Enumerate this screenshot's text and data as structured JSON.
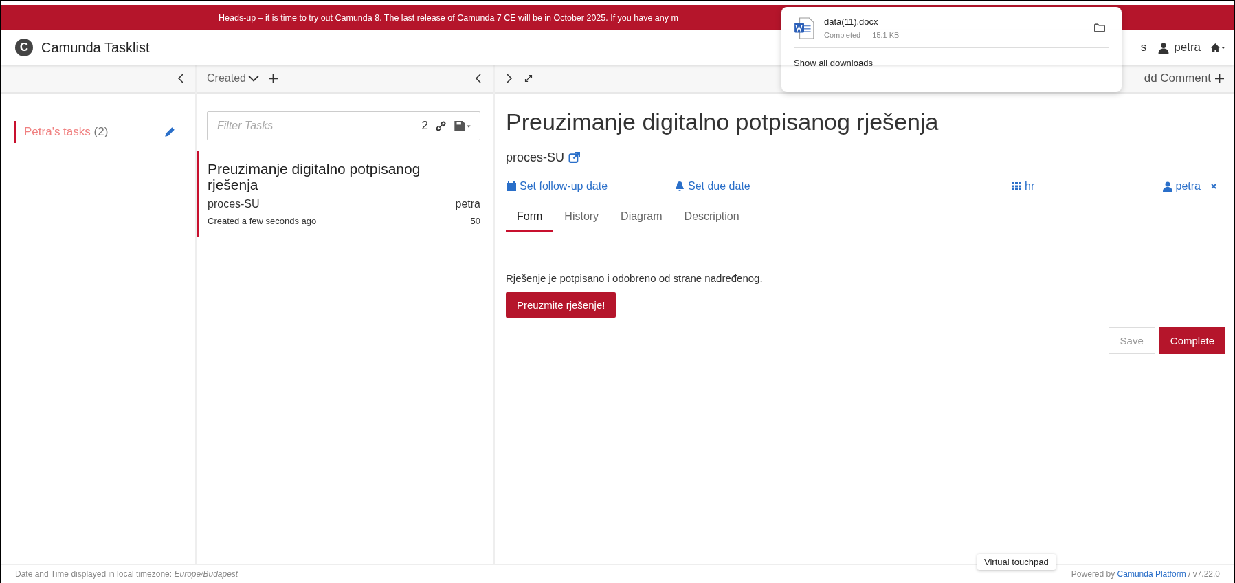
{
  "banner": {
    "text": "Heads-up – it is time to try out Camunda 8. The last release of Camunda 7 CE will be in October 2025. If you have any m"
  },
  "header": {
    "logo": "C",
    "title": "Camunda Tasklist",
    "links": [
      {
        "kind": "text",
        "label": "s"
      },
      {
        "kind": "user",
        "label": "petra"
      },
      {
        "kind": "home"
      }
    ]
  },
  "filters_column": {
    "filters": [
      {
        "name": "Petra's tasks",
        "count": "(2)",
        "selected": true
      }
    ]
  },
  "list_column": {
    "sort_label": "Created",
    "filter": {
      "placeholder": "Filter Tasks",
      "count": "2"
    },
    "tasks": [
      {
        "name": "Preuzimanje digitalno potpisanog rješenja",
        "process": "proces-SU",
        "assignee": "petra",
        "created": "Created a few seconds ago",
        "priority": "50",
        "selected": true
      }
    ]
  },
  "task": {
    "add_comment": "dd Comment",
    "title": "Preuzimanje digitalno potpisanog rješenja",
    "process": "proces-SU",
    "actions": [
      {
        "kind": "calendar",
        "label": "Set follow-up date"
      },
      {
        "kind": "bell",
        "label": "Set due date"
      },
      {
        "kind": "group",
        "label": "hr"
      },
      {
        "kind": "user",
        "label": "petra"
      }
    ],
    "tabs": [
      {
        "label": "Form",
        "selected": true
      },
      {
        "label": "History",
        "selected": false
      },
      {
        "label": "Diagram",
        "selected": false
      },
      {
        "label": "Description",
        "selected": false
      }
    ],
    "form": {
      "text": "Rješenje je potpisano i odobreno od strane nadređenog.",
      "button": "Preuzmite rješenje!"
    },
    "buttons": [
      {
        "kind": "secondary",
        "label": "Save"
      },
      {
        "kind": "primary",
        "label": "Complete"
      }
    ]
  },
  "footer": {
    "timezone": "Date and Time displayed in local timezone: *Europe/Budapest*",
    "powered_prefix": "Powered by",
    "powered_link": "Camunda Platform",
    "version": "/ v7.22.0"
  },
  "downloads_popup": {
    "file": "data(11).docx",
    "status": "Completed — 15.1 KB",
    "show_all": "Show all downloads"
  },
  "tooltip": "Virtual touchpad"
}
